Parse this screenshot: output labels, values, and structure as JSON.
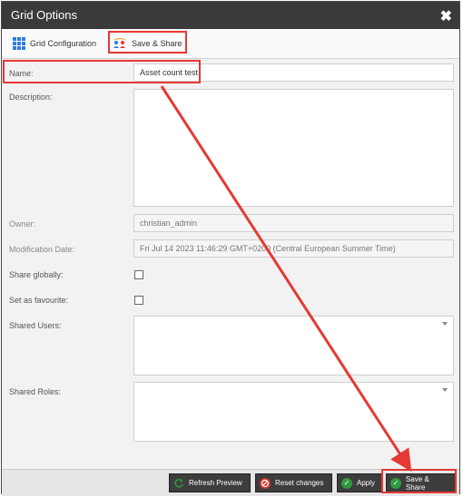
{
  "dialog": {
    "title": "Grid Options",
    "close_glyph": "✖"
  },
  "tabs": [
    {
      "label": "Grid Configuration",
      "icon": "grid-icon"
    },
    {
      "label": "Save & Share",
      "icon": "share-icon"
    }
  ],
  "form": {
    "name": {
      "label": "Name:",
      "value": "Asset count test"
    },
    "description": {
      "label": "Description:",
      "value": ""
    },
    "owner": {
      "label": "Owner:",
      "value": "christian_admin"
    },
    "modification_date": {
      "label": "Modification Date:",
      "value": "Fri Jul 14 2023 11:46:29 GMT+0200 (Central European Summer Time)"
    },
    "share_globally": {
      "label": "Share globally:",
      "checked": false
    },
    "set_as_favourite": {
      "label": "Set as favourite:",
      "checked": false
    },
    "shared_users": {
      "label": "Shared Users:"
    },
    "shared_roles": {
      "label": "Shared Roles:"
    }
  },
  "footer": {
    "buttons": [
      {
        "label": "Refresh Preview",
        "icon": "refresh-icon"
      },
      {
        "label": "Reset changes",
        "icon": "reset-icon"
      },
      {
        "label": "Apply",
        "icon": "check-icon"
      },
      {
        "label": "Save & Share",
        "icon": "check-icon"
      }
    ]
  },
  "colors": {
    "annotation": "#e53935",
    "titlebar": "#3a3a3a",
    "button": "#3d3d3d",
    "accent": "#2b7de1",
    "check_green": "#2e9a3e",
    "reset_red": "#d9352b"
  }
}
